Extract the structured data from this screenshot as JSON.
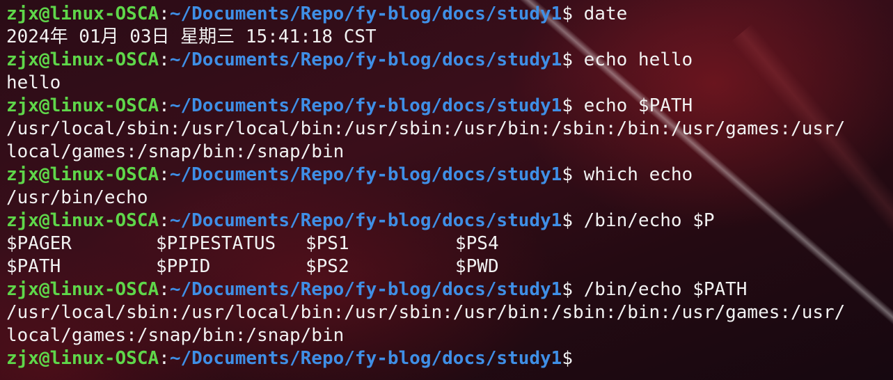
{
  "prompt": {
    "user_host": "zjx@linux-OSCA",
    "colon": ":",
    "path": "~/Documents/Repo/fy-blog/docs/study1",
    "symbol": "$ "
  },
  "lines": [
    {
      "type": "prompt",
      "cmd": "date"
    },
    {
      "type": "output",
      "text": "2024年 01月 03日 星期三 15:41:18 CST"
    },
    {
      "type": "prompt",
      "cmd": "echo hello"
    },
    {
      "type": "output",
      "text": "hello"
    },
    {
      "type": "prompt",
      "cmd": "echo $PATH"
    },
    {
      "type": "output",
      "text": "/usr/local/sbin:/usr/local/bin:/usr/sbin:/usr/bin:/sbin:/bin:/usr/games:/usr/"
    },
    {
      "type": "output",
      "text": "local/games:/snap/bin:/snap/bin"
    },
    {
      "type": "prompt",
      "cmd": "which echo"
    },
    {
      "type": "output",
      "text": "/usr/bin/echo"
    },
    {
      "type": "prompt",
      "cmd": "/bin/echo $P"
    },
    {
      "type": "columns",
      "cells": [
        "$PAGER",
        "$PIPESTATUS",
        "$PS1",
        "$PS4"
      ]
    },
    {
      "type": "columns",
      "cells": [
        "$PATH",
        "$PPID",
        "$PS2",
        "$PWD"
      ]
    },
    {
      "type": "prompt",
      "cmd": "/bin/echo $PATH"
    },
    {
      "type": "output",
      "text": "/usr/local/sbin:/usr/local/bin:/usr/sbin:/usr/bin:/sbin:/bin:/usr/games:/usr/"
    },
    {
      "type": "output",
      "text": "local/games:/snap/bin:/snap/bin"
    },
    {
      "type": "prompt",
      "cmd": ""
    }
  ],
  "colors": {
    "user_host": "#5fd74a",
    "path": "#3f8fe6",
    "text": "#f2f2f2",
    "background": "#2a0c16"
  }
}
